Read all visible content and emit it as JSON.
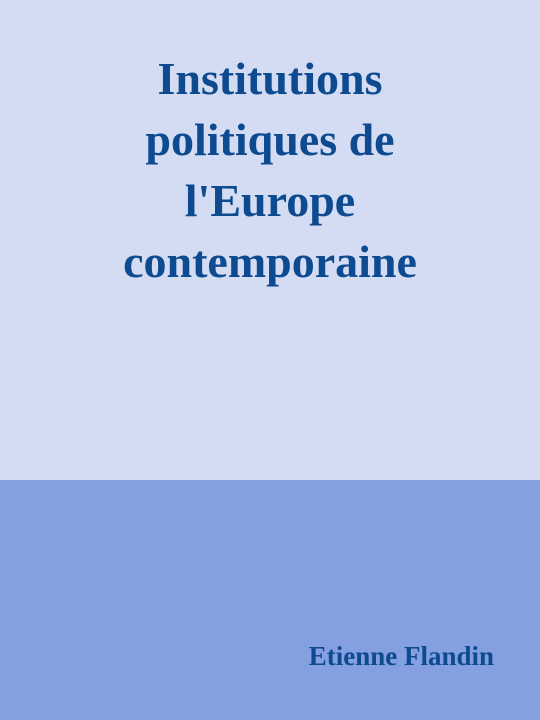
{
  "cover": {
    "title_lines": [
      "Institutions",
      "politiques de",
      "l'Europe",
      "contemporaine"
    ],
    "author": "Etienne Flandin"
  },
  "colors": {
    "top_background": "#d3dcf3",
    "bottom_background": "#84a0e1",
    "text": "#0d4a8f"
  }
}
